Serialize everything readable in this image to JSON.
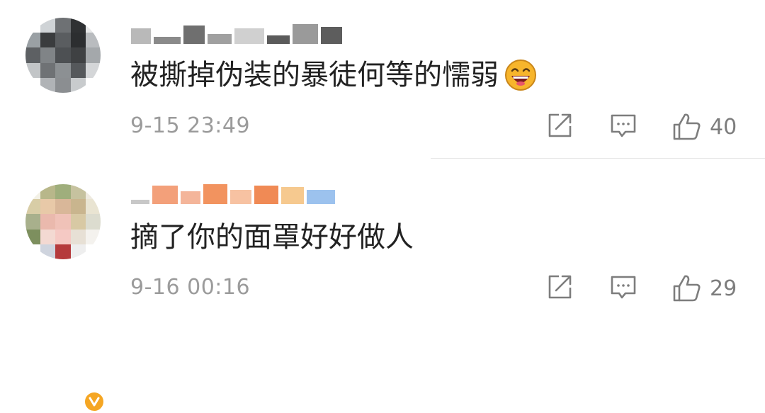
{
  "comments": [
    {
      "text": "被撕掉伪装的暴徒何等的懦弱",
      "emoji_icon": "laughing-face-icon",
      "timestamp": "9-15 23:49",
      "likes": "40",
      "verified": false
    },
    {
      "text": "摘了你的面罩好好做人",
      "timestamp": "9-16 00:16",
      "likes": "29",
      "verified": true
    }
  ],
  "icons": {
    "share": "share-icon",
    "reply": "comment-icon",
    "like": "thumbs-up-icon",
    "verified": "verified-badge-icon"
  },
  "colors": {
    "comment_text": "#222222",
    "meta_text": "#9b9b9b",
    "icon_stroke": "#7d7d7d",
    "verified_badge": "#f5a623"
  }
}
